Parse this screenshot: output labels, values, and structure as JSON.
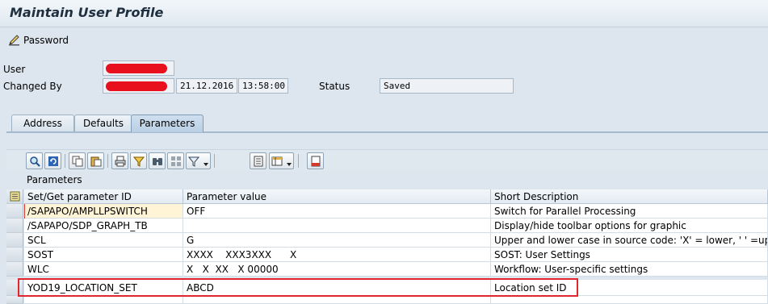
{
  "window": {
    "title": "Maintain User Profile"
  },
  "toolbar": {
    "password_label": "Password"
  },
  "header": {
    "user_label": "User",
    "changed_by_label": "Changed By",
    "changed_date": "21.12.2016",
    "changed_time": "13:58:00",
    "status_label": "Status",
    "status_value": "Saved"
  },
  "tabs": [
    {
      "label": "Address"
    },
    {
      "label": "Defaults"
    },
    {
      "label": "Parameters"
    }
  ],
  "alv_toolbar_icons": [
    "find-icon",
    "refresh-icon",
    "copy-icon",
    "paste-icon",
    "print-icon",
    "filter-icon",
    "find-next-icon",
    "sum-icon",
    "funnel-menu-icon",
    "print-preview-icon",
    "layout-menu-icon",
    "export-icon"
  ],
  "grid": {
    "title": "Parameters",
    "columns": [
      "Set/Get parameter ID",
      "Parameter value",
      "Short Description"
    ],
    "rows": [
      [
        "/SAPAPO/AMPLLPSWITCH",
        "OFF",
        "Switch for Parallel Processing"
      ],
      [
        "/SAPAPO/SDP_GRAPH_TB",
        "",
        "Display/hide toolbar options for graphic"
      ],
      [
        "SCL",
        "G",
        "Upper and lower case in source code: 'X' = lower, ' ' =upper"
      ],
      [
        "SOST",
        "XXXX    XXX3XXX      X",
        "SOST: User Settings"
      ],
      [
        "WLC",
        "X   X  XX   X 00000",
        "Workflow: User-specific settings"
      ],
      [
        "YOD19_LOCATION_SET",
        "ABCD",
        "Location set ID"
      ]
    ]
  },
  "colors": {
    "highlight_box": "#e0262f",
    "redaction": "#e8101c"
  }
}
